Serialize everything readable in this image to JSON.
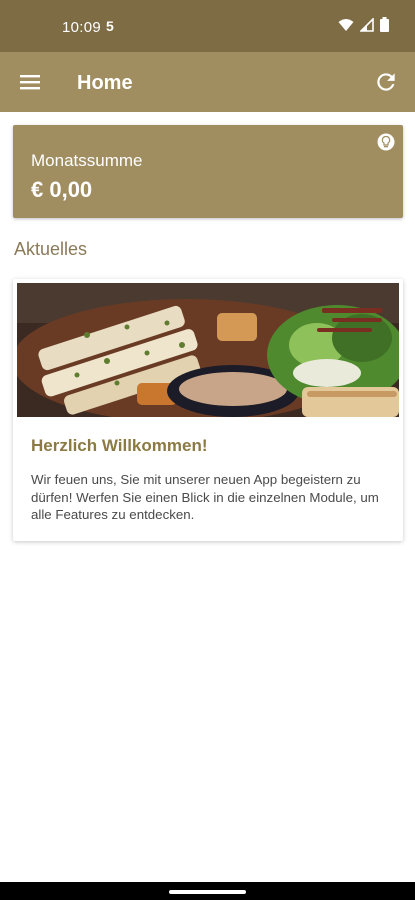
{
  "status_bar": {
    "time": "10:09",
    "sim_indicator": "5",
    "icons": [
      "wifi-icon",
      "signal-icon",
      "battery-icon"
    ]
  },
  "app_bar": {
    "title": "Home",
    "menu_icon": "menu-icon",
    "refresh_icon": "refresh-icon"
  },
  "summary": {
    "label": "Monatssumme",
    "value": "€ 0,00",
    "icon": "lightbulb-icon"
  },
  "section": {
    "title": "Aktuelles"
  },
  "news": [
    {
      "image": "food-photo",
      "title": "Herzlich Willkommen!",
      "body": "Wir feuen uns, Sie mit unserer neuen App begeistern zu dürfen! Werfen Sie einen Blick in die einzelnen Module, um alle Features zu entdecken."
    }
  ],
  "colors": {
    "status_bar": "#7e6c45",
    "primary": "#a08d60",
    "accent_text": "#8c7a45",
    "section_text": "#8a7a58"
  }
}
